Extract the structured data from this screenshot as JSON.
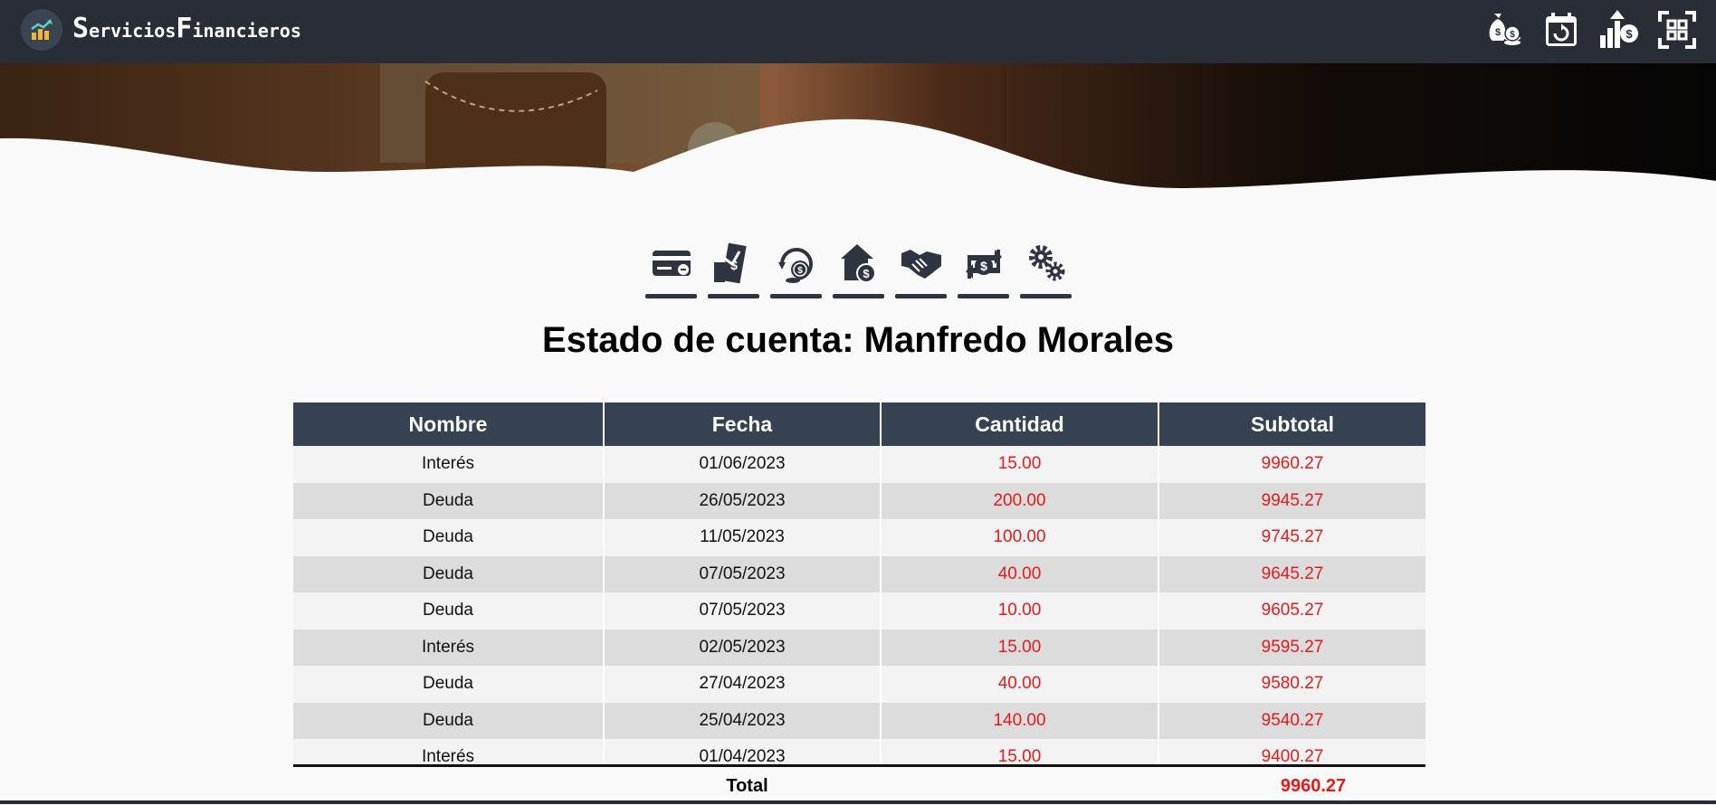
{
  "brand": {
    "first_initial": "S",
    "first_rest": "ervicios",
    "second_initial": "F",
    "second_rest": "inancieros"
  },
  "nav_icons": [
    "money-bag-coins-icon",
    "calendar-refresh-icon",
    "growth-dollar-icon",
    "scan-icon"
  ],
  "actions": [
    {
      "name": "credit-card-icon"
    },
    {
      "name": "money-transfer-icon"
    },
    {
      "name": "coin-refresh-icon"
    },
    {
      "name": "home-dollar-icon"
    },
    {
      "name": "handshake-icon"
    },
    {
      "name": "dollar-exchange-icon"
    },
    {
      "name": "settings-gears-icon"
    }
  ],
  "title": "Estado de cuenta: Manfredo Morales",
  "table": {
    "headers": [
      "Nombre",
      "Fecha",
      "Cantidad",
      "Subtotal"
    ],
    "rows": [
      [
        "Interés",
        "01/06/2023",
        "15.00",
        "9960.27"
      ],
      [
        "Deuda",
        "26/05/2023",
        "200.00",
        "9945.27"
      ],
      [
        "Deuda",
        "11/05/2023",
        "100.00",
        "9745.27"
      ],
      [
        "Deuda",
        "07/05/2023",
        "40.00",
        "9645.27"
      ],
      [
        "Deuda",
        "07/05/2023",
        "10.00",
        "9605.27"
      ],
      [
        "Interés",
        "02/05/2023",
        "15.00",
        "9595.27"
      ],
      [
        "Deuda",
        "27/04/2023",
        "40.00",
        "9580.27"
      ],
      [
        "Deuda",
        "25/04/2023",
        "140.00",
        "9540.27"
      ],
      [
        "Interés",
        "01/04/2023",
        "15.00",
        "9400.27"
      ]
    ],
    "total_label": "Total",
    "total_value": "9960.27"
  },
  "colors": {
    "navbar": "#282d36",
    "header": "#364152",
    "negative": "#e41b1b"
  }
}
